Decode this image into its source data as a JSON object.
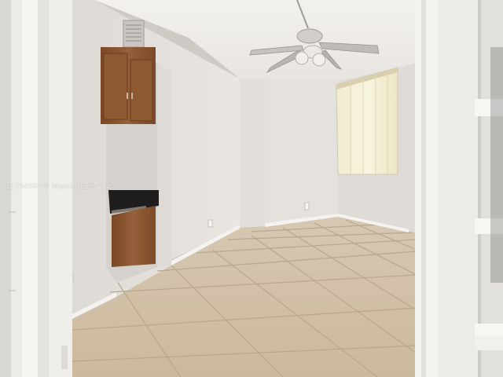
{
  "photo": {
    "subject": "",
    "watermark": "A11754502 © Miami MLS® 2025"
  },
  "colors": {
    "wall": "#e6e3df",
    "wall_shade": "#d2cec9",
    "ceiling": "#f1efec",
    "floor": "#d3c3ab",
    "grout": "#b4a48c",
    "cabinet": "#8a5630",
    "countertop": "#1e1c1c",
    "trim": "#f5f5f3",
    "window_glow": "#f4eed0"
  }
}
